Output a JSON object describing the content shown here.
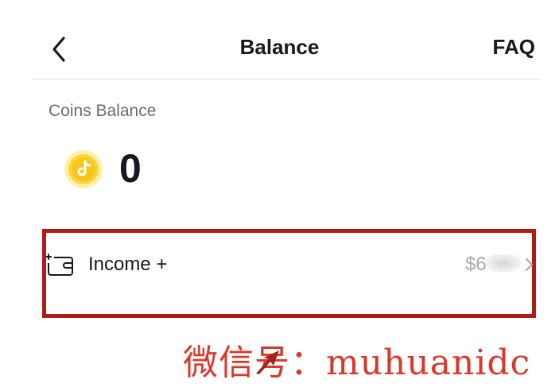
{
  "header": {
    "title": "Balance",
    "faq_label": "FAQ",
    "back_icon": "chevron-left-icon"
  },
  "coins": {
    "label": "Coins Balance",
    "amount": "0",
    "icon": "coin-icon"
  },
  "income": {
    "label": "Income +",
    "value": "$6",
    "icon": "wallet-icon",
    "chevron_icon": "chevron-right-icon"
  },
  "watermark": {
    "text": "微信号：muhuanidc"
  },
  "colors": {
    "highlight_border": "#b41a14",
    "coin_yellow": "#fbd438",
    "watermark_red": "#d9382d",
    "text_primary": "#161823",
    "text_secondary": "#6b6c73"
  }
}
